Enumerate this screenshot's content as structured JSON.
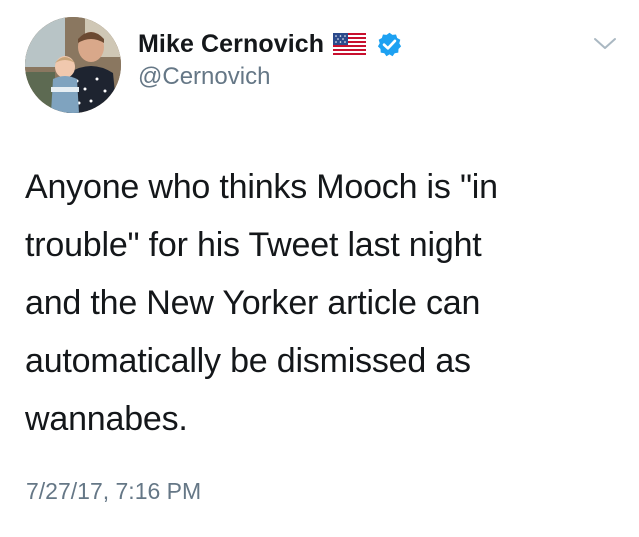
{
  "author": {
    "display_name": "Mike Cernovich",
    "handle": "@Cernovich",
    "avatar_icon": "profile-photo",
    "badges": [
      "us-flag-icon",
      "verified-badge-icon"
    ],
    "verified_color": "#1da1f2"
  },
  "tweet": {
    "text": "Anyone who thinks Mooch is \"in\ntrouble\" for his Tweet last night\nand the New Yorker article can\nautomatically be dismissed as\nwannabes.",
    "timestamp": "7/27/17, 7:16 PM"
  },
  "menu": {
    "icon": "chevron-down-icon"
  },
  "colors": {
    "text": "#14171a",
    "secondary": "#657786",
    "background": "#ffffff"
  }
}
